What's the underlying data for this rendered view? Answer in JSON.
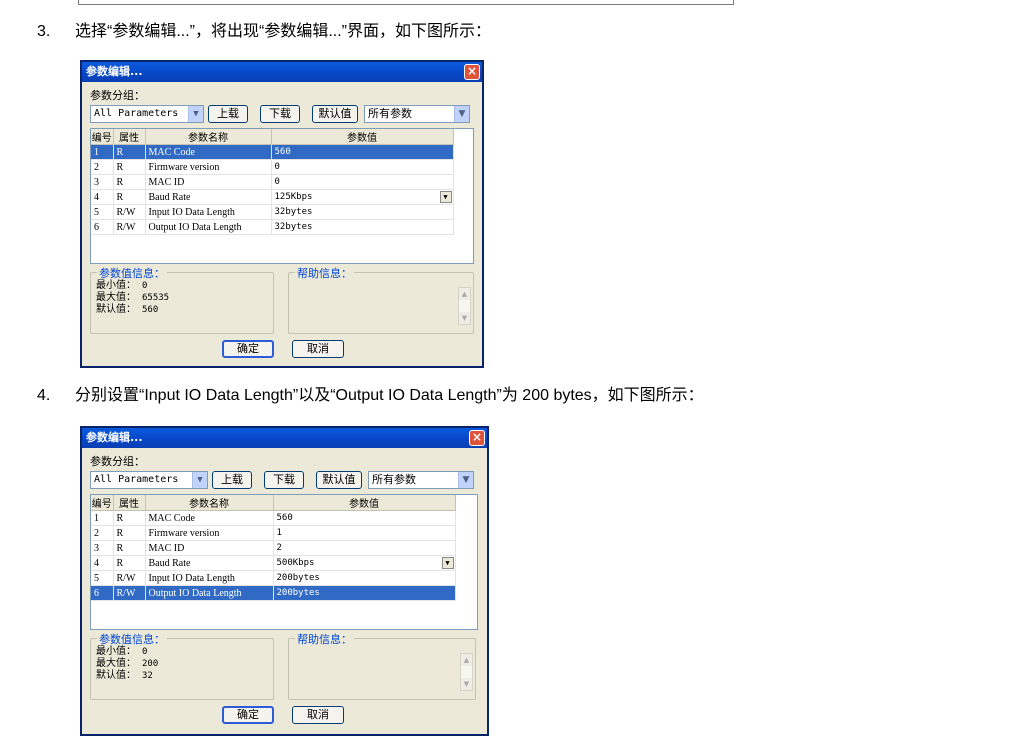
{
  "step3": {
    "num": "3.",
    "text": "选择“参数编辑...”，将出现“参数编辑...”界面，如下图所示："
  },
  "step4": {
    "num": "4.",
    "text": "分别设置“Input IO Data Length”以及“Output IO Data Length”为 200 bytes，如下图所示："
  },
  "dialogs": [
    {
      "title": "参数编辑...",
      "group_label": "参数分组：",
      "group_value": "All Parameters",
      "upload": "上载",
      "download": "下载",
      "default": "默认值",
      "filter_value": "所有参数",
      "columns": [
        "编号",
        "属性",
        "参数名称",
        "参数值"
      ],
      "rows": [
        {
          "id": "1",
          "attr": "R",
          "name": "MAC Code",
          "value": "560"
        },
        {
          "id": "2",
          "attr": "R",
          "name": "Firmware version",
          "value": "0"
        },
        {
          "id": "3",
          "attr": "R",
          "name": "MAC ID",
          "value": "0"
        },
        {
          "id": "4",
          "attr": "R",
          "name": "Baud Rate",
          "value": "125Kbps"
        },
        {
          "id": "5",
          "attr": "R/W",
          "name": "Input IO Data Length",
          "value": "32bytes"
        },
        {
          "id": "6",
          "attr": "R/W",
          "name": "Output IO Data Length",
          "value": "32bytes"
        }
      ],
      "selected_row": 0,
      "param_info_caption": "参数值信息：",
      "min_label": "最小值：",
      "min": "0",
      "max_label": "最大值：",
      "max": "65535",
      "def_label": "默认值：",
      "def": "560",
      "help_caption": "帮助信息：",
      "ok": "确定",
      "cancel": "取消"
    },
    {
      "title": "参数编辑...",
      "group_label": "参数分组：",
      "group_value": "All Parameters",
      "upload": "上载",
      "download": "下载",
      "default": "默认值",
      "filter_value": "所有参数",
      "columns": [
        "编号",
        "属性",
        "参数名称",
        "参数值"
      ],
      "rows": [
        {
          "id": "1",
          "attr": "R",
          "name": "MAC Code",
          "value": "560"
        },
        {
          "id": "2",
          "attr": "R",
          "name": "Firmware version",
          "value": "1"
        },
        {
          "id": "3",
          "attr": "R",
          "name": "MAC ID",
          "value": "2"
        },
        {
          "id": "4",
          "attr": "R",
          "name": "Baud Rate",
          "value": "500Kbps"
        },
        {
          "id": "5",
          "attr": "R/W",
          "name": "Input IO Data Length",
          "value": "200bytes"
        },
        {
          "id": "6",
          "attr": "R/W",
          "name": "Output IO Data Length",
          "value": "200bytes"
        }
      ],
      "selected_row": 5,
      "param_info_caption": "参数值信息：",
      "min_label": "最小值：",
      "min": "0",
      "max_label": "最大值：",
      "max": "200",
      "def_label": "默认值：",
      "def": "32",
      "help_caption": "帮助信息：",
      "ok": "确定",
      "cancel": "取消"
    }
  ]
}
